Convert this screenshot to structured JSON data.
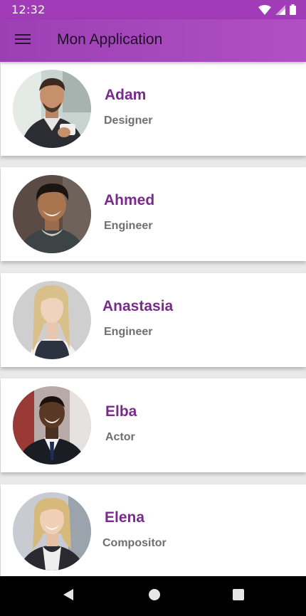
{
  "status_bar": {
    "time": "12:32",
    "icons": [
      "wifi-icon",
      "signal-icon",
      "battery-icon"
    ]
  },
  "app_bar": {
    "title": "Mon Application",
    "menu_icon": "hamburger-menu-icon"
  },
  "contacts": [
    {
      "name": "Adam",
      "role": "Designer"
    },
    {
      "name": "Ahmed",
      "role": "Engineer"
    },
    {
      "name": "Anastasia",
      "role": "Engineer"
    },
    {
      "name": "Elba",
      "role": "Actor"
    },
    {
      "name": "Elena",
      "role": "Compositor"
    }
  ],
  "nav_bar": {
    "icons": [
      "back-icon",
      "home-icon",
      "recents-icon"
    ]
  },
  "colors": {
    "accent": "#a23bb8",
    "name_text": "#7a2a8c",
    "role_text": "#6f6f6f"
  }
}
